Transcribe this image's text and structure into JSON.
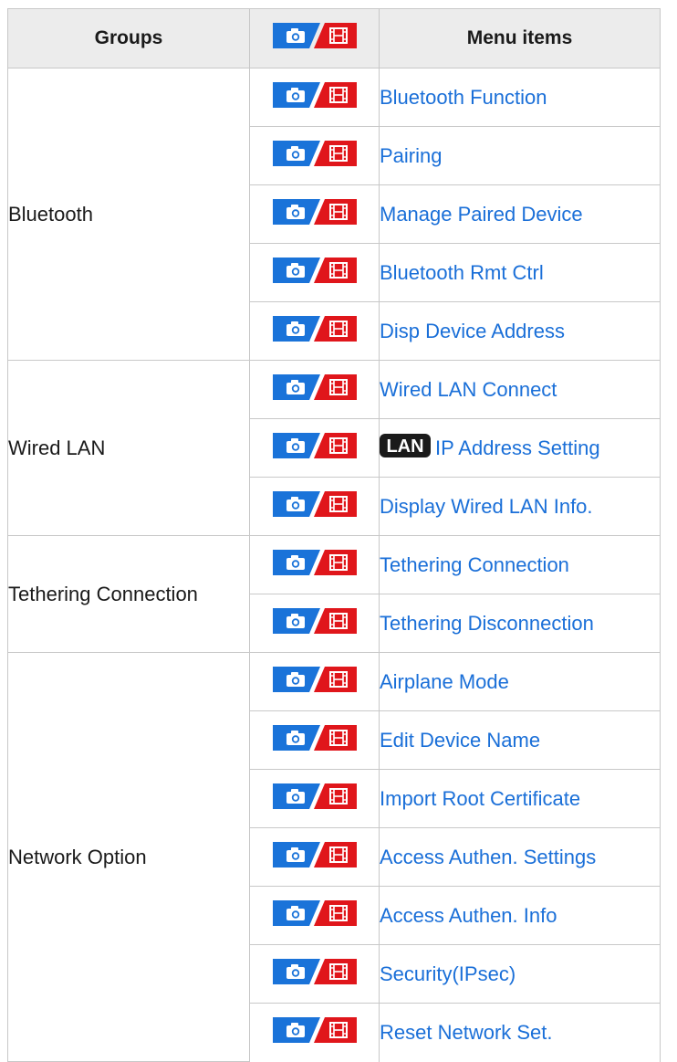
{
  "table": {
    "headers": {
      "groups": "Groups",
      "items": "Menu items",
      "mode_icon": "camera-movie-icon"
    },
    "groups": [
      {
        "name": "Bluetooth",
        "items": [
          "Bluetooth Function",
          "Pairing",
          "Manage Paired Device",
          "Bluetooth Rmt Ctrl",
          "Disp Device Address"
        ]
      },
      {
        "name": "Wired LAN",
        "items": [
          "Wired LAN Connect",
          "IP Address Setting",
          "Display Wired LAN Info."
        ],
        "item_icons": {
          "1": {
            "icon": "lan-icon",
            "text": "LAN"
          }
        }
      },
      {
        "name": "Tethering Connection",
        "items": [
          "Tethering Connection",
          "Tethering Disconnection"
        ]
      },
      {
        "name": "Network Option",
        "items": [
          "Airplane Mode",
          "Edit Device Name",
          "Import Root Certificate",
          "Access Authen. Settings",
          "Access Authen. Info",
          "Security(IPsec)",
          "Reset Network Set."
        ]
      }
    ]
  },
  "colors": {
    "camera_badge": "#1a73d9",
    "movie_badge": "#e0161b",
    "link": "#1a6fd8",
    "header_bg": "#ececec",
    "border": "#c8c8c8"
  }
}
